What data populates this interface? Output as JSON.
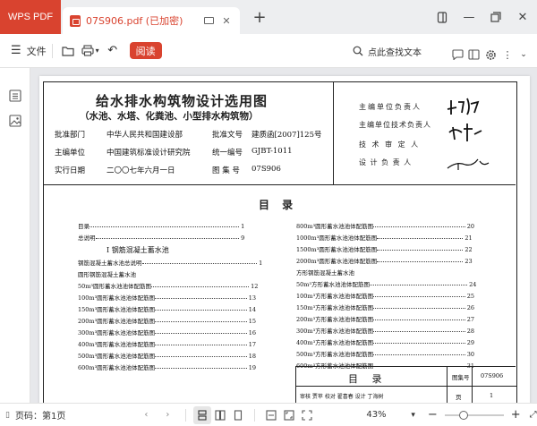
{
  "tabs": {
    "app_label": "WPS PDF",
    "doc_title": "07S906.pdf (已加密)",
    "new_tab": "+"
  },
  "toolbar": {
    "file_label": "文件",
    "read_label": "阅读",
    "search_placeholder": "点此查找文本"
  },
  "document": {
    "title": "给水排水构筑物设计选用图",
    "subtitle": "（水池、水塔、化粪池、小型排水构筑物）",
    "fields": {
      "approve_dept_label": "批准部门",
      "approve_dept_value": "中华人民共和国建设部",
      "approve_doc_label": "批准文号",
      "approve_doc_value": "建质函[2007]125号",
      "editor_unit_label": "主编单位",
      "editor_unit_value": "中国建筑标准设计研究院",
      "unified_no_label": "统一编号",
      "unified_no_value": "GJBT-1011",
      "impl_date_label": "实行日期",
      "impl_date_value": "二〇〇七年六月一日",
      "atlas_no_label": "图 集 号",
      "atlas_no_value": "07S906"
    },
    "responsibility": [
      "主编单位负责人",
      "主编单位技术负责人",
      "技 术 审 定 人",
      "设 计 负 责 人"
    ],
    "contents_title": "目 录",
    "toc_left": [
      {
        "t": "目录",
        "p": "1"
      },
      {
        "t": "总说明",
        "p": "9"
      }
    ],
    "section1": "I  钢筋混凝土蓄水池",
    "toc_left2": [
      {
        "t": "钢筋混凝土蓄水池总说明",
        "p": "1"
      },
      {
        "t": "圆形钢筋混凝土蓄水池",
        "p": ""
      },
      {
        "t": "50m³圆形蓄水池池体配筋图",
        "p": "12"
      },
      {
        "t": "100m³圆形蓄水池池体配筋图",
        "p": "13"
      },
      {
        "t": "150m³圆形蓄水池池体配筋图",
        "p": "14"
      },
      {
        "t": "200m³圆形蓄水池池体配筋图",
        "p": "15"
      },
      {
        "t": "300m³圆形蓄水池池体配筋图",
        "p": "16"
      },
      {
        "t": "400m³圆形蓄水池池体配筋图",
        "p": "17"
      },
      {
        "t": "500m³圆形蓄水池池体配筋图",
        "p": "18"
      },
      {
        "t": "600m³圆形蓄水池池体配筋图",
        "p": "19"
      }
    ],
    "toc_right": [
      {
        "t": "800m³圆形蓄水池池体配筋图",
        "p": "20"
      },
      {
        "t": "1000m³圆形蓄水池池体配筋图",
        "p": "21"
      },
      {
        "t": "1500m³圆形蓄水池池体配筋图",
        "p": "22"
      },
      {
        "t": "2000m³圆形蓄水池池体配筋图",
        "p": "23"
      },
      {
        "t": "方形钢筋混凝土蓄水池",
        "p": ""
      },
      {
        "t": "50m³方形蓄水池池体配筋图",
        "p": "24"
      },
      {
        "t": "100m³方形蓄水池池体配筋图",
        "p": "25"
      },
      {
        "t": "150m³方形蓄水池池体配筋图",
        "p": "26"
      },
      {
        "t": "200m³方形蓄水池池体配筋图",
        "p": "27"
      },
      {
        "t": "300m³方形蓄水池池体配筋图",
        "p": "28"
      },
      {
        "t": "400m³方形蓄水池池体配筋图",
        "p": "29"
      },
      {
        "t": "500m³方形蓄水池池体配筋图",
        "p": "30"
      },
      {
        "t": "600m³方形蓄水池池体配筋图",
        "p": "31"
      }
    ],
    "box_title": "目 录",
    "box_atlas_label": "图集号",
    "box_atlas_value": "07S906",
    "box_page_label": "页",
    "box_page_value": "1",
    "box_row": "审核 贾苹 校对 翟喜春 设计 丁海树"
  },
  "status": {
    "page_label": "页码：第1页",
    "zoom": "43%"
  },
  "colors": {
    "accent": "#d9432f"
  }
}
